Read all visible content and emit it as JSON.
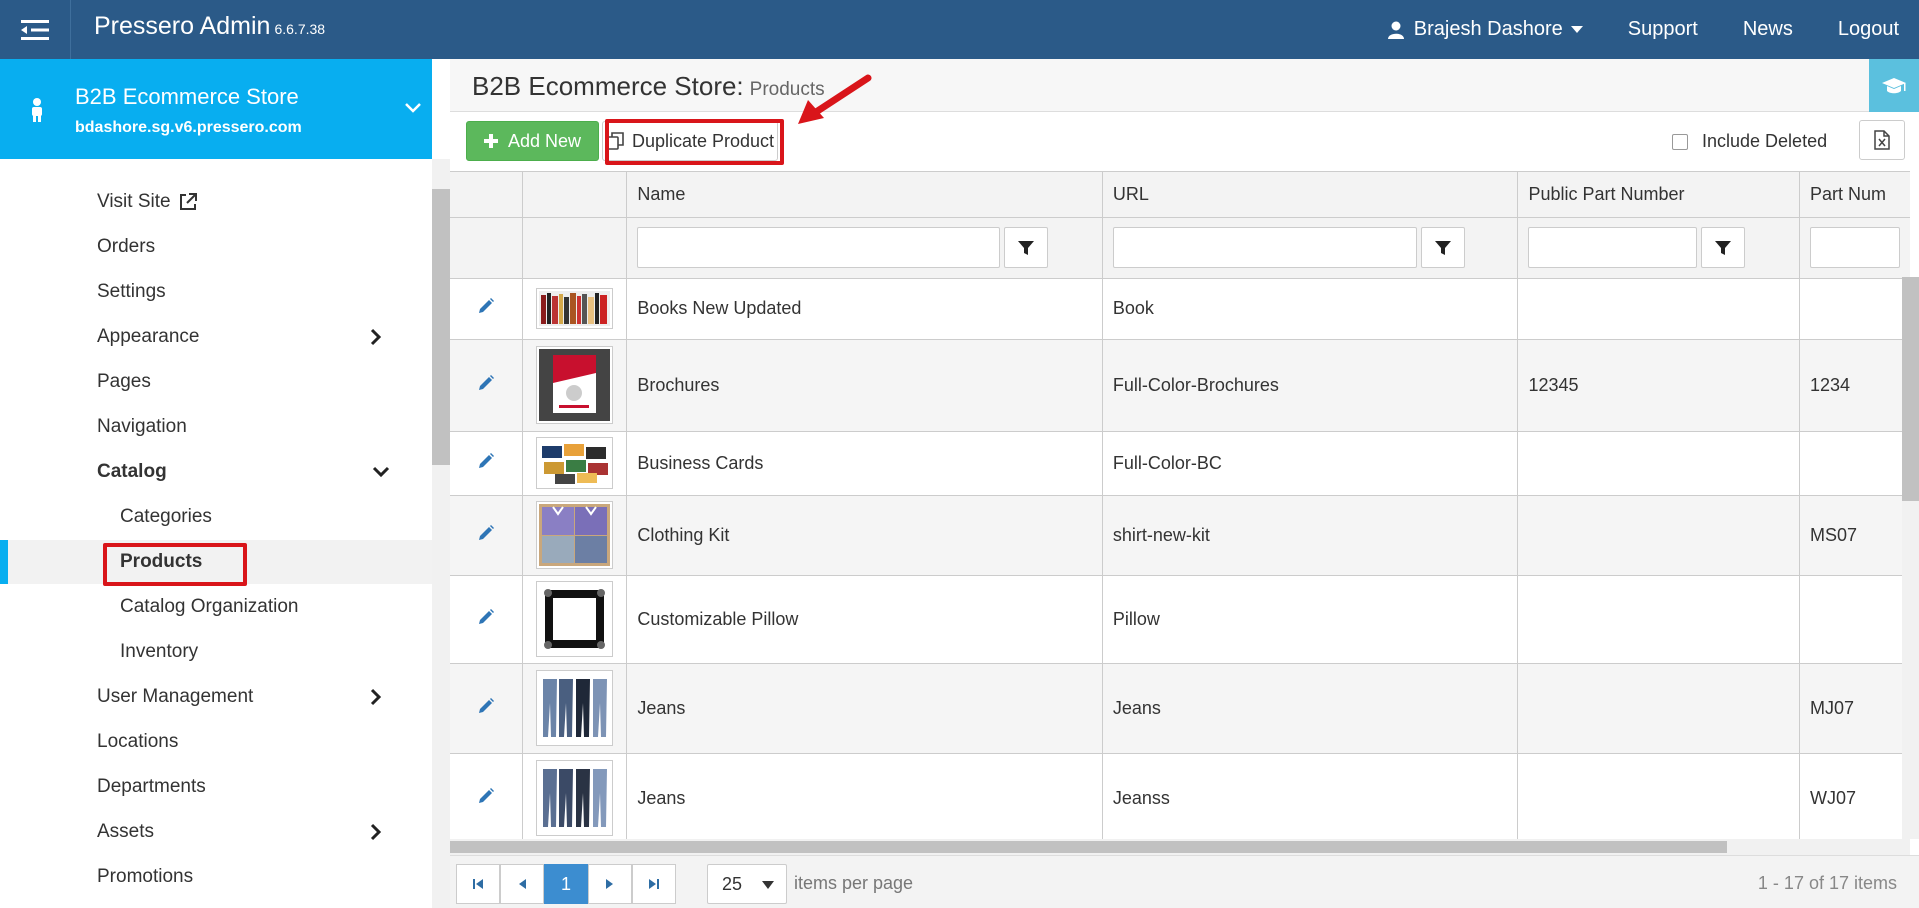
{
  "header": {
    "app_title": "Pressero Admin",
    "app_version": "6.6.7.38",
    "user_name": "Brajesh Dashore",
    "nav": [
      "Support",
      "News",
      "Logout"
    ]
  },
  "store": {
    "name": "B2B Ecommerce Store",
    "url": "bdashore.sg.v6.pressero.com"
  },
  "sidebar": {
    "items": [
      {
        "label": "Visit Site"
      },
      {
        "label": "Orders"
      },
      {
        "label": "Settings"
      },
      {
        "label": "Appearance"
      },
      {
        "label": "Pages"
      },
      {
        "label": "Navigation"
      },
      {
        "label": "Catalog"
      },
      {
        "label": "Categories"
      },
      {
        "label": "Products"
      },
      {
        "label": "Catalog Organization"
      },
      {
        "label": "Inventory"
      },
      {
        "label": "User Management"
      },
      {
        "label": "Locations"
      },
      {
        "label": "Departments"
      },
      {
        "label": "Assets"
      },
      {
        "label": "Promotions"
      }
    ]
  },
  "page": {
    "title": "B2B Ecommerce Store:",
    "subtitle": "Products"
  },
  "toolbar": {
    "add_label": "Add New",
    "duplicate_label": "Duplicate Product",
    "include_deleted_label": "Include Deleted"
  },
  "grid": {
    "columns": [
      "Name",
      "URL",
      "Public Part Number",
      "Part Num"
    ],
    "rows": [
      {
        "name": "Books New Updated",
        "url": "Book",
        "public_part": "",
        "part": ""
      },
      {
        "name": "Brochures",
        "url": "Full-Color-Brochures",
        "public_part": "12345",
        "part": "1234"
      },
      {
        "name": "Business Cards",
        "url": "Full-Color-BC",
        "public_part": "",
        "part": ""
      },
      {
        "name": "Clothing Kit",
        "url": "shirt-new-kit",
        "public_part": "",
        "part": "MS07"
      },
      {
        "name": "Customizable Pillow",
        "url": "Pillow",
        "public_part": "",
        "part": ""
      },
      {
        "name": "Jeans",
        "url": "Jeans",
        "public_part": "",
        "part": "MJ07"
      },
      {
        "name": "Jeans",
        "url": "Jeanss",
        "public_part": "",
        "part": "WJ07"
      }
    ]
  },
  "pager": {
    "current_page": "1",
    "page_size": "25",
    "items_per_page_label": "items per page",
    "info": "1 - 17 of 17 items"
  },
  "colors": {
    "topbar": "#2b5a88",
    "store_panel": "#08aef0",
    "add_button": "#5cb85c",
    "highlight": "#d9151a"
  }
}
